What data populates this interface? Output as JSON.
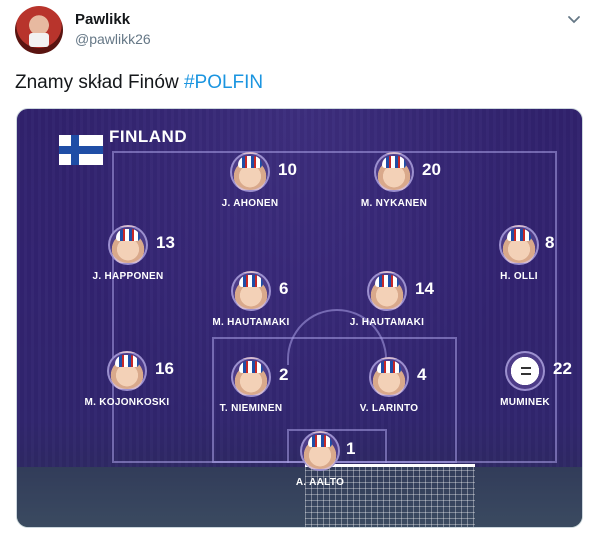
{
  "tweet": {
    "author_name": "Pawlikk",
    "author_handle": "@pawlikk26",
    "text": "Znamy skład Finów",
    "hashtag": "#POLFIN"
  },
  "lineup": {
    "team": "FINLAND",
    "players": [
      {
        "name": "J. AHONEN",
        "number": "10"
      },
      {
        "name": "M. NYKANEN",
        "number": "20"
      },
      {
        "name": "J. HAPPONEN",
        "number": "13"
      },
      {
        "name": "H. OLLI",
        "number": "8"
      },
      {
        "name": "M. HAUTAMAKI",
        "number": "6"
      },
      {
        "name": "J. HAUTAMAKI",
        "number": "14"
      },
      {
        "name": "M. KOJONKOSKI",
        "number": "16"
      },
      {
        "name": "T. NIEMINEN",
        "number": "2"
      },
      {
        "name": "V. LARINTO",
        "number": "4"
      },
      {
        "name": "MUMINEK",
        "number": "22"
      },
      {
        "name": "A. AALTO",
        "number": "1"
      }
    ]
  },
  "colors": {
    "hashtag": "#1b95e0",
    "pitch_overlay": "#3a2a80",
    "flag_blue": "#1f4ea6"
  },
  "icons": [
    "chevron-down-icon",
    "finland-flag-icon",
    "player-face-icon",
    "moomin-icon"
  ]
}
